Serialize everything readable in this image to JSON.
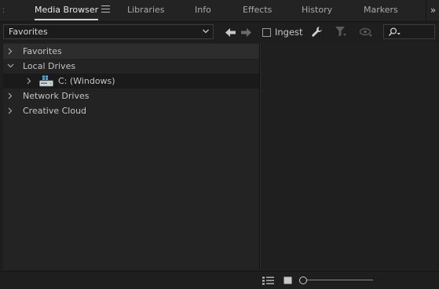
{
  "tabs": [
    {
      "label": "Media Browser",
      "active": true
    },
    {
      "label": "Libraries",
      "active": false
    },
    {
      "label": "Info",
      "active": false
    },
    {
      "label": "Effects",
      "active": false
    },
    {
      "label": "History",
      "active": false
    },
    {
      "label": "Markers",
      "active": false
    }
  ],
  "tab_overflow": "»",
  "toolbar": {
    "location_value": "Favorites",
    "ingest_label": "Ingest",
    "ingest_checked": false
  },
  "tree": {
    "items": [
      {
        "label": "Favorites",
        "expanded": false
      },
      {
        "label": "Local Drives",
        "expanded": true
      },
      {
        "label": "C: (Windows)",
        "expanded": false
      },
      {
        "label": "Network Drives",
        "expanded": false
      },
      {
        "label": "Creative Cloud",
        "expanded": false
      }
    ]
  },
  "colors": {
    "panel_bg": "#232323",
    "selected_row": "#2d2d2d",
    "drive_icon": "#5ea9d6"
  }
}
